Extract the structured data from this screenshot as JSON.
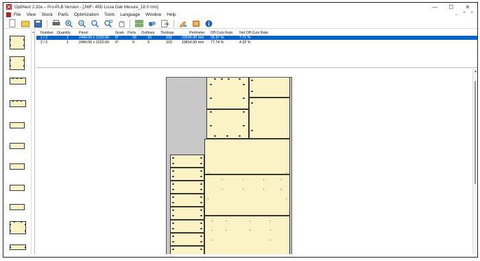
{
  "window": {
    "title": "OptiNest 2.32e – Pro-PLB Version - [JWF- 49D Lissa Oak Mesure_18.0 mm]",
    "minimize_glyph": "—",
    "maximize_glyph": "☐",
    "close_glyph": "✕"
  },
  "menu": {
    "items": [
      "File",
      "View",
      "Stock",
      "Parts",
      "Optimization",
      "Tools",
      "Language",
      "Window",
      "Help"
    ],
    "mdi_controls": "_ × ×"
  },
  "toolbar": {
    "buttons": [
      "new-icon",
      "open-icon",
      "save-icon",
      "print-icon",
      "zoom-in-icon",
      "zoom-out-icon",
      "zoom-fit-icon",
      "zoom-window-icon",
      "pan-icon",
      "layout-icon",
      "parts-icon",
      "export-icon",
      "edit-icon",
      "settings-icon",
      "info-icon"
    ]
  },
  "table": {
    "headers": [
      "Number",
      "Quantity",
      "Panel",
      "Grain",
      "Parts",
      "Outlines",
      "Toolings",
      "Perimeter",
      "Off-Cuts Rate",
      "Net Off-Cuts Rate"
    ],
    "rows": [
      [
        "1 / 2",
        "1",
        "2440.00 x 1220.00",
        "0°",
        "16",
        "16",
        "332",
        "22934.00 mm",
        "25.37 %",
        "7.71 %"
      ],
      [
        "2 / 2",
        "1",
        "2440.00 x 1220.00",
        "0°",
        "9",
        "9",
        "103",
        "10814.00 mm",
        "77.74 %",
        "4.32 %"
      ]
    ],
    "selected_row": 0,
    "selection_color": "#0a64c8"
  },
  "colors": {
    "part_fill": "#fbf3c6",
    "offcut_fill": "#c8c8c8",
    "brand_red": "#c41a1a"
  }
}
